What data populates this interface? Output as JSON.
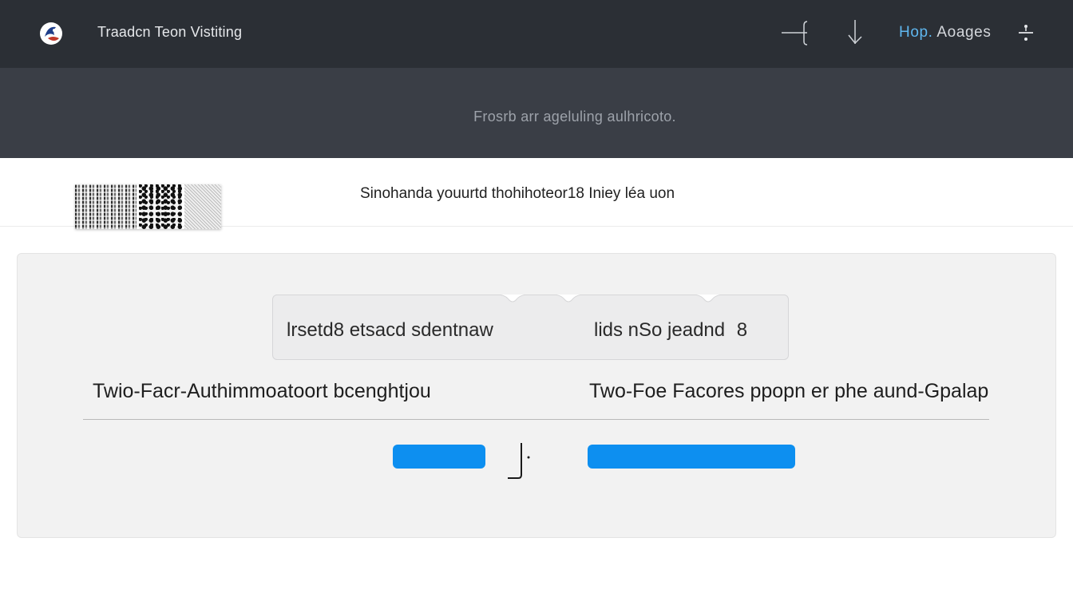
{
  "header": {
    "title": "Traadcn Teon Vistiting",
    "logo_icon": "app-logo-icon",
    "icons": [
      "line-tool-icon",
      "arrow-down-icon",
      "sparkle-icon"
    ],
    "link_accent": "Hop.",
    "link_rest": " Aoages",
    "accent_color": "#5fb7ef"
  },
  "banner": {
    "text": "Frosrb arr ageluling  aulhricoto."
  },
  "strip": {
    "text": "Sinohanda youurtd thohihoteor18 Iniey léa uon"
  },
  "card": {
    "selector_left": "lrsetd8 etsacd sdentnaw",
    "selector_right": "lids nSo jeadnd",
    "selector_count": "8",
    "heading_left": "Twio-Facr-Authimmoatoort bcenghtjou",
    "heading_right": "Two-Foe Facores ppopn er phe aund-Gpalap",
    "button_color": "#0d8ff0"
  }
}
